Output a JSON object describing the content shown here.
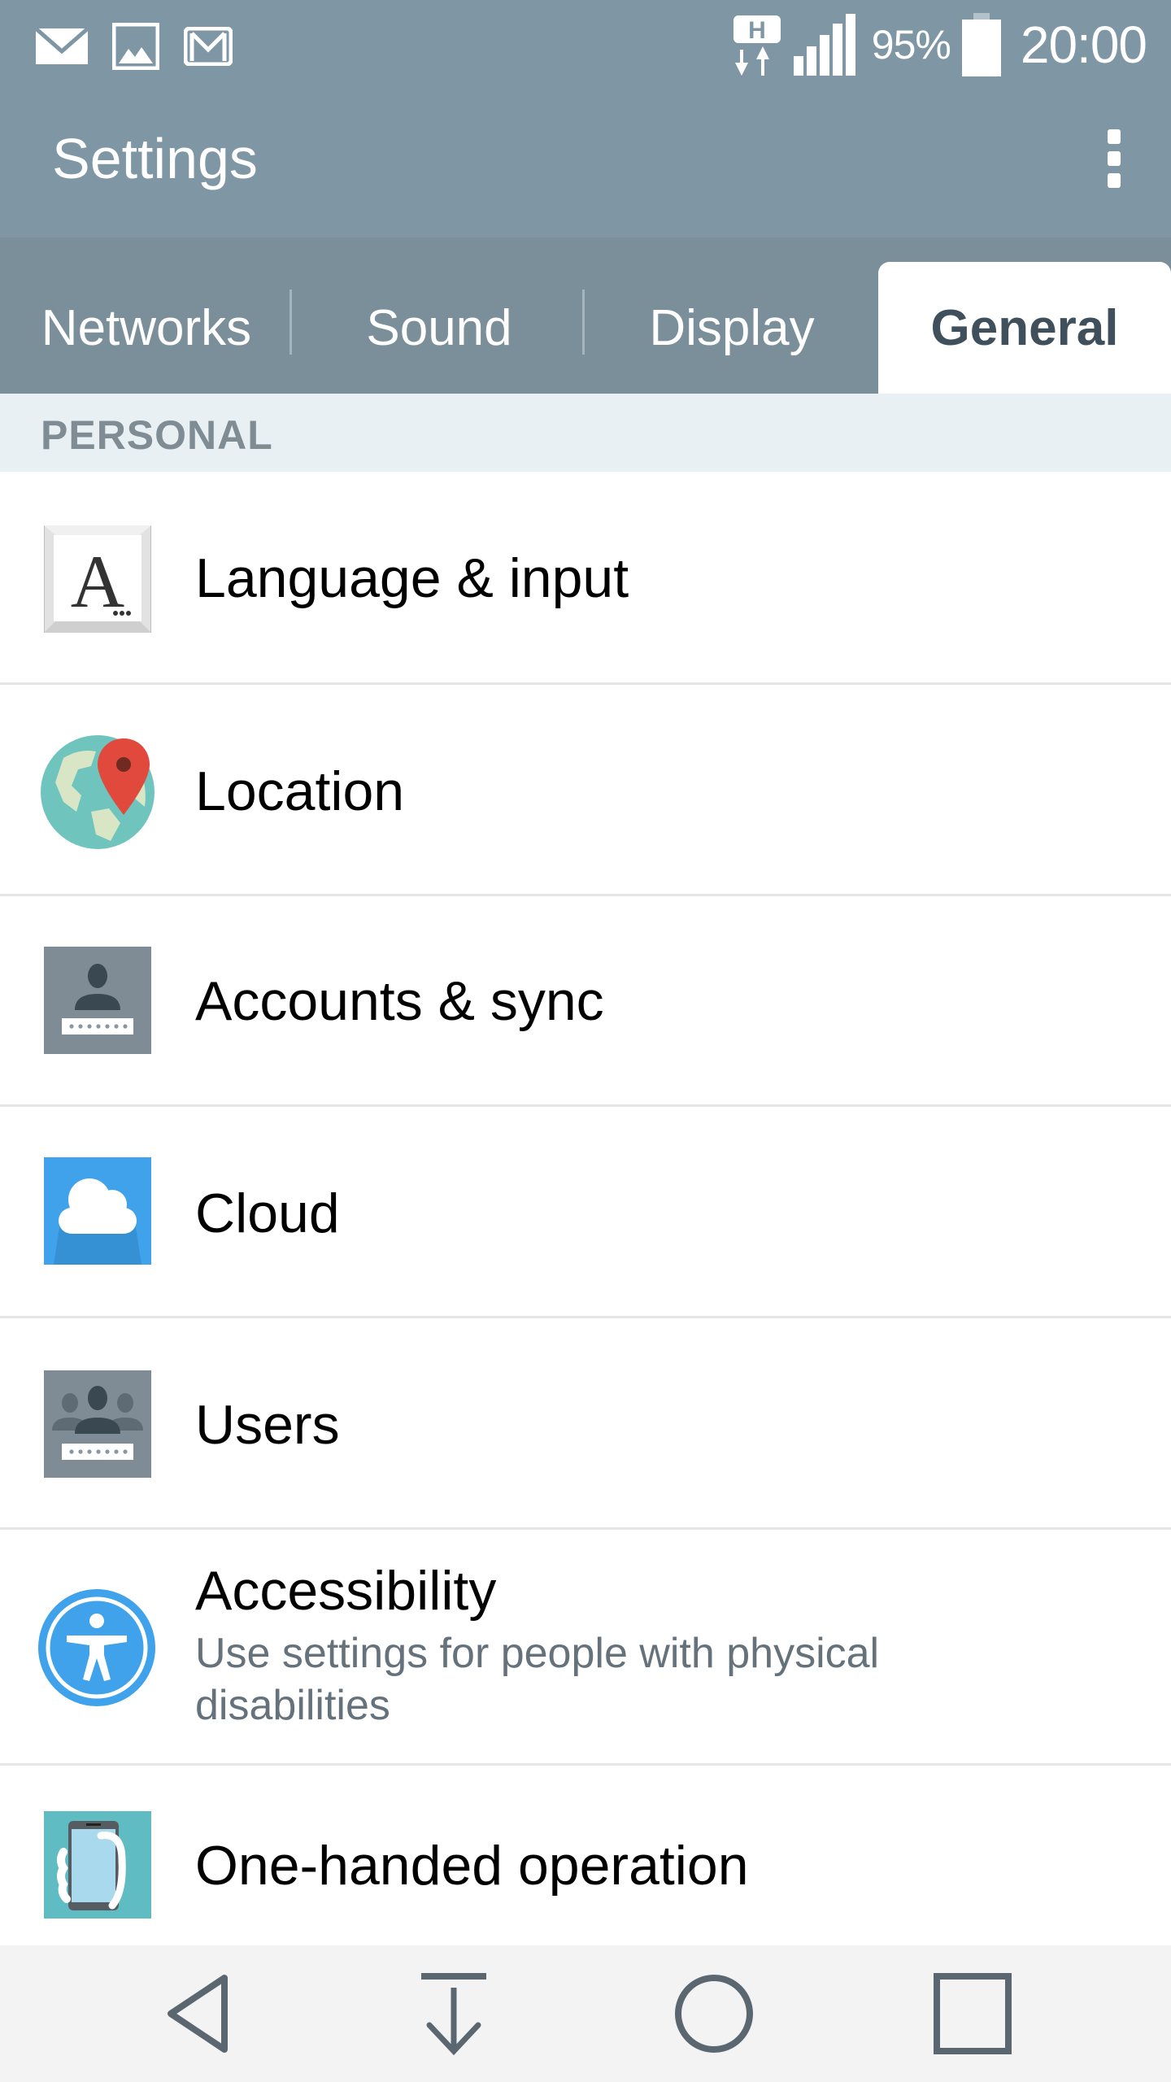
{
  "status_bar": {
    "notification_icons": [
      "email-icon",
      "image-icon",
      "gmail-icon"
    ],
    "network_type": "H",
    "signal_icon": "signal-bars-icon",
    "battery_percent": "95%",
    "battery_icon": "battery-icon",
    "time": "20:00"
  },
  "app_bar": {
    "title": "Settings",
    "overflow_icon": "more-vert-icon"
  },
  "tabs": [
    {
      "label": "Networks",
      "active": false
    },
    {
      "label": "Sound",
      "active": false
    },
    {
      "label": "Display",
      "active": false
    },
    {
      "label": "General",
      "active": true
    }
  ],
  "section": {
    "label": "PERSONAL"
  },
  "items": [
    {
      "title": "Language & input",
      "icon": "language-icon"
    },
    {
      "title": "Location",
      "icon": "location-globe-icon"
    },
    {
      "title": "Accounts & sync",
      "icon": "accounts-icon"
    },
    {
      "title": "Cloud",
      "icon": "cloud-icon"
    },
    {
      "title": "Users",
      "icon": "users-icon"
    },
    {
      "title": "Accessibility",
      "subtitle": "Use settings for people with physical disabilities",
      "icon": "accessibility-icon"
    },
    {
      "title": "One-handed operation",
      "icon": "one-handed-icon"
    }
  ],
  "nav_bar": {
    "buttons": [
      "back-icon",
      "notification-pulldown-icon",
      "home-icon",
      "recents-icon"
    ]
  },
  "colors": {
    "header": "#7f97a5",
    "tab_bar": "#7a8f9a",
    "active_tab_text": "#3f4f5b",
    "section_bg": "#e8f0f3",
    "accent_blue": "#3fa2ea"
  }
}
